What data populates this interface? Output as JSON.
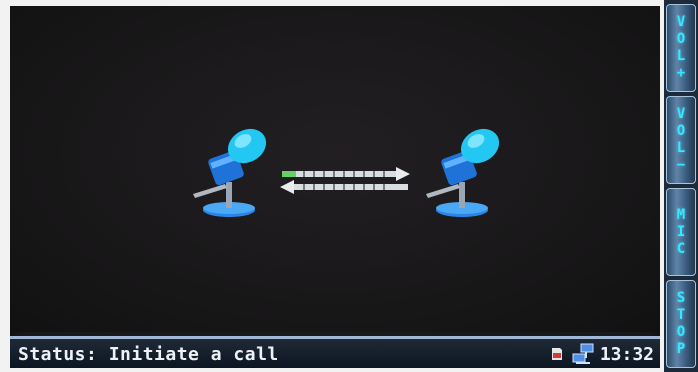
{
  "status": {
    "label": "Status: Initiate a call",
    "clock": "13:32",
    "sd_icon": "sd-card-icon",
    "network_icon": "network-icon"
  },
  "side_buttons": [
    {
      "id": "vol-plus",
      "letters": [
        "V",
        "O",
        "L",
        "+"
      ]
    },
    {
      "id": "vol-minus",
      "letters": [
        "V",
        "O",
        "L",
        "−"
      ]
    },
    {
      "id": "mic",
      "letters": [
        "M",
        "I",
        "C"
      ]
    },
    {
      "id": "stop",
      "letters": [
        "S",
        "T",
        "O",
        "P"
      ]
    }
  ],
  "icons": {
    "left_mic": "microphone-icon",
    "right_mic": "microphone-icon",
    "exchange": "bidirectional-arrows-icon"
  },
  "colors": {
    "mic_head": "#23c8f2",
    "mic_body": "#1f72d8",
    "button_text": "#39e6ff",
    "status_bar": "#0f1b28"
  }
}
